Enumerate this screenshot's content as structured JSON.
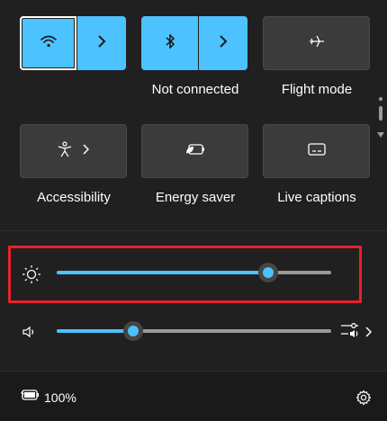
{
  "quick_settings": {
    "wifi": {
      "icon": "wifi-icon",
      "state": "on",
      "expand_icon": "chevron-right-icon"
    },
    "bluetooth": {
      "icon": "bluetooth-icon",
      "state": "on",
      "label": "Not connected",
      "expand_icon": "chevron-right-icon"
    },
    "flight_mode": {
      "icon": "airplane-icon",
      "state": "off",
      "label": "Flight mode"
    },
    "accessibility": {
      "icon": "accessibility-icon",
      "label": "Accessibility",
      "expand_icon": "chevron-right-icon"
    },
    "energy_saver": {
      "icon": "battery-leaf-icon",
      "label": "Energy saver"
    },
    "live_captions": {
      "icon": "captions-icon",
      "label": "Live captions"
    }
  },
  "brightness": {
    "icon": "sun-icon",
    "value_fraction": 0.77
  },
  "volume": {
    "icon": "speaker-icon",
    "value_fraction": 0.28,
    "output_icon": "sound-output-icon",
    "expand_icon": "chevron-right-icon"
  },
  "footer": {
    "battery_icon": "battery-charging-icon",
    "battery_text": "100%",
    "settings_icon": "gear-icon"
  },
  "colors": {
    "accent": "#4cc2ff",
    "panel": "#202020",
    "tile": "#3b3b3b",
    "highlight": "#e8212c"
  }
}
